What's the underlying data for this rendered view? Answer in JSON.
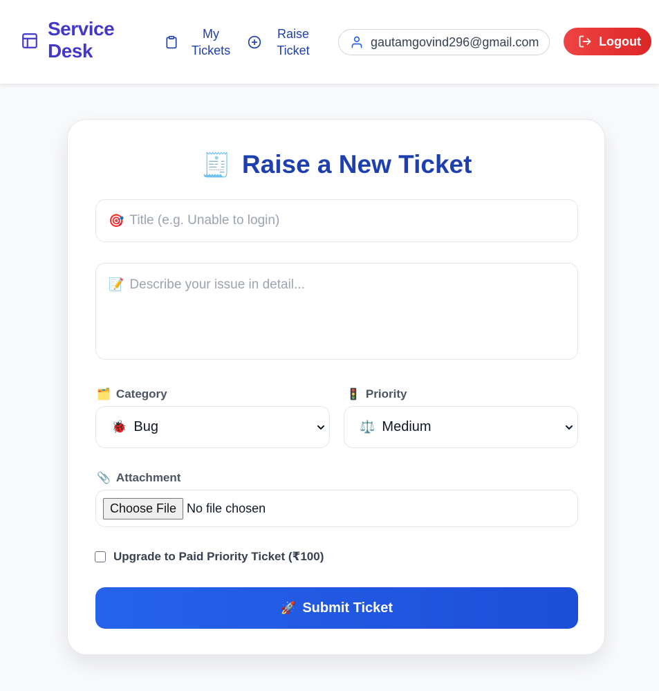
{
  "header": {
    "brand": {
      "icon": "layout-panel-icon",
      "title": "Service Desk"
    },
    "nav": [
      {
        "label": "My Tickets",
        "icon": "clipboard-icon"
      },
      {
        "label": "Raise Ticket",
        "icon": "plus-circle-icon"
      }
    ],
    "user": {
      "icon": "user-icon",
      "email": "gautamgovind296@gmail.com"
    },
    "logout": {
      "label": "Logout",
      "icon": "log-out-icon"
    }
  },
  "form": {
    "title_emoji": "🧾",
    "title": "Raise a New Ticket",
    "title_field": {
      "emoji": "🎯",
      "placeholder": "Title (e.g. Unable to login)",
      "value": ""
    },
    "description_field": {
      "emoji": "📝",
      "placeholder": "Describe your issue in detail...",
      "value": ""
    },
    "category": {
      "emoji": "🗂️",
      "label": "Category",
      "selected_emoji": "🐞",
      "selected": "Bug"
    },
    "priority": {
      "emoji": "🚦",
      "label": "Priority",
      "selected_emoji": "⚖️",
      "selected": "Medium"
    },
    "attachment": {
      "emoji": "📎",
      "label": "Attachment",
      "button_label": "Choose File",
      "status": "No file chosen"
    },
    "upgrade": {
      "checked": false,
      "label": "Upgrade to Paid Priority Ticket (₹100)"
    },
    "submit": {
      "emoji": "🚀",
      "label": "Submit Ticket"
    }
  },
  "colors": {
    "brand": "#4338ca",
    "nav_text": "#1e40af",
    "title": "#1e40af",
    "logout": "#ef4444",
    "submit": "#2563eb"
  }
}
